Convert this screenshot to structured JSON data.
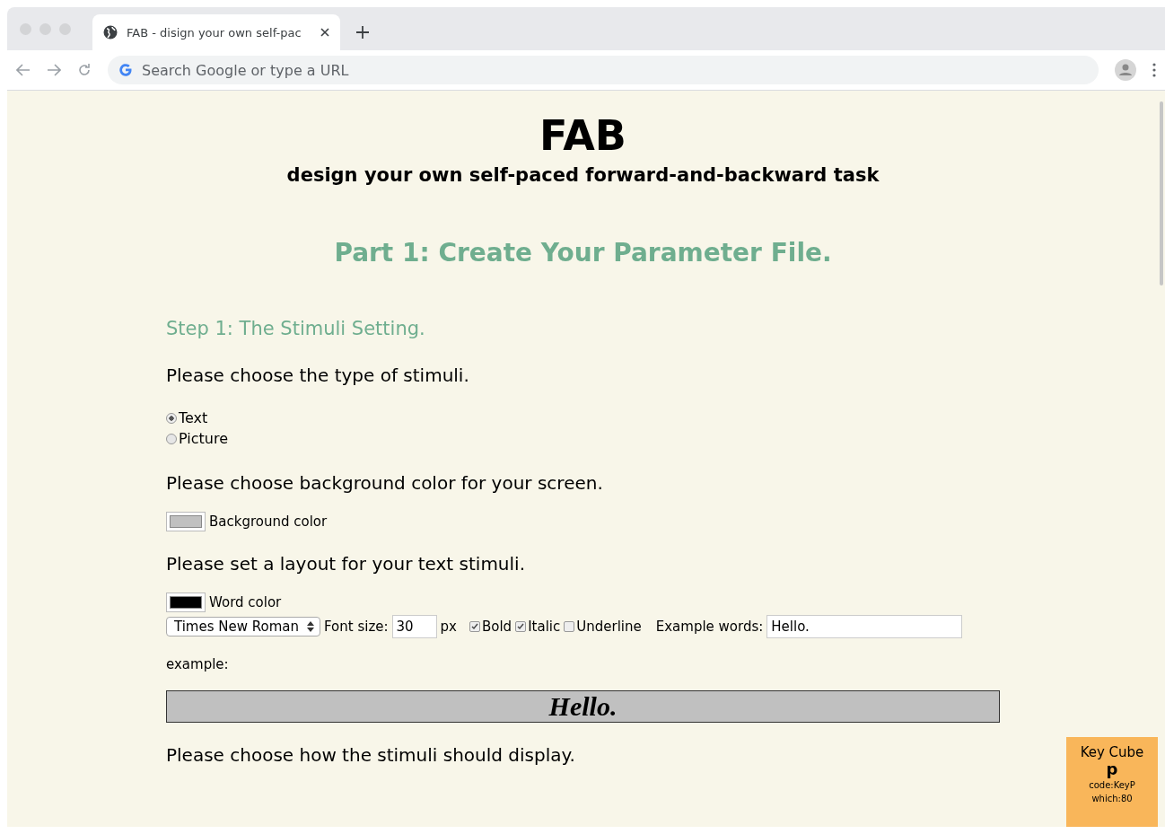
{
  "browser": {
    "tab_title": "FAB - disign your own self-pac",
    "address_placeholder": "Search Google or type a URL"
  },
  "page": {
    "title": "FAB",
    "subtitle": "design your own self-paced forward-and-backward task",
    "part_heading": "Part 1: Create Your Parameter File.",
    "step_heading": "Step 1: The Stimuli Setting.",
    "stimuli_question": "Please choose the type of stimuli.",
    "stimuli_options": [
      {
        "label": "Text",
        "selected": true
      },
      {
        "label": "Picture",
        "selected": false
      }
    ],
    "background_question": "Please choose background color for your screen.",
    "background_color": {
      "label": "Background color",
      "color": "#c0c0c0"
    },
    "layout_question": "Please set a layout for your text stimuli.",
    "word_color": {
      "label": "Word color",
      "color": "#000000"
    },
    "font_select": {
      "value": "Times New Roman"
    },
    "font_size": {
      "label": "Font size:",
      "value": "30",
      "unit": "px"
    },
    "style_options": [
      {
        "label": "Bold",
        "checked": true
      },
      {
        "label": "Italic",
        "checked": true
      },
      {
        "label": "Underline",
        "checked": false
      }
    ],
    "example_words": {
      "label": "Example words:",
      "value": "Hello."
    },
    "example_label": "example:",
    "preview_text": "Hello.",
    "display_question": "Please choose how the stimuli should display."
  },
  "key_cube": {
    "title": "Key Cube",
    "key": "p",
    "code": "code:KeyP",
    "which": "which:80"
  }
}
